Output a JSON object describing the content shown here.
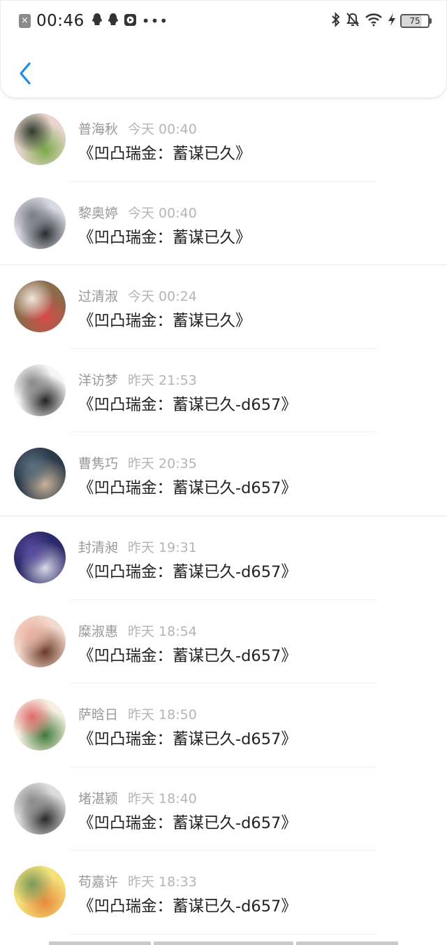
{
  "status_bar": {
    "time": "00:46",
    "battery": "75",
    "left_icons": [
      "close-box-icon",
      "qq-icon",
      "qq-icon",
      "play-box-icon"
    ],
    "right_icons": [
      "bluetooth-icon",
      "bell-muted-icon",
      "wifi-icon",
      "charging-icon"
    ]
  },
  "header": {
    "back_icon": "chevron-left-icon",
    "accent_color": "#1e8ce6"
  },
  "messages": [
    {
      "name": "普海秋",
      "time": "今天 00:40",
      "text": "《凹凸瑞金：蓄谋已久》",
      "avatar_colors": [
        "#e8d6cc",
        "#7aa84a",
        "#2e3a2a"
      ]
    },
    {
      "name": "黎奥婷",
      "time": "今天 00:40",
      "text": "《凹凸瑞金：蓄谋已久》",
      "avatar_colors": [
        "#d9d9e3",
        "#2b2b33",
        "#7c7c88"
      ]
    },
    {
      "name": "过清淑",
      "time": "今天 00:24",
      "text": "《凹凸瑞金：蓄谋已久》",
      "avatar_colors": [
        "#8a6b4a",
        "#d94a4a",
        "#f0e6da"
      ]
    },
    {
      "name": "洋访梦",
      "time": "昨天 21:53",
      "text": "《凹凸瑞金：蓄谋已久-d657》",
      "avatar_colors": [
        "#f5f5f5",
        "#222222",
        "#888888"
      ]
    },
    {
      "name": "曹隽巧",
      "time": "昨天 20:35",
      "text": "《凹凸瑞金：蓄谋已久-d657》",
      "avatar_colors": [
        "#2c3a4a",
        "#c9b39a",
        "#5a7080"
      ]
    },
    {
      "name": "封清昶",
      "time": "昨天 19:31",
      "text": "《凹凸瑞金：蓄谋已久-d657》",
      "avatar_colors": [
        "#2a2a6a",
        "#d8d8e8",
        "#5a4aa0"
      ]
    },
    {
      "name": "糜淑惠",
      "time": "昨天 18:54",
      "text": "《凹凸瑞金：蓄谋已久-d657》",
      "avatar_colors": [
        "#f3d8cc",
        "#6a3a2a",
        "#e8b0a0"
      ]
    },
    {
      "name": "萨晗日",
      "time": "昨天 18:50",
      "text": "《凹凸瑞金：蓄谋已久-d657》",
      "avatar_colors": [
        "#f7efe2",
        "#3f7a3a",
        "#e06a6a"
      ]
    },
    {
      "name": "堵湛颖",
      "time": "昨天 18:40",
      "text": "《凹凸瑞金：蓄谋已久-d657》",
      "avatar_colors": [
        "#dcdcdc",
        "#2a2a2a",
        "#8a8a8a"
      ]
    },
    {
      "name": "苟嘉许",
      "time": "昨天 18:33",
      "text": "《凹凸瑞金：蓄谋已久-d657》",
      "avatar_colors": [
        "#f5e07a",
        "#e88a3a",
        "#7a9a5a"
      ]
    }
  ]
}
